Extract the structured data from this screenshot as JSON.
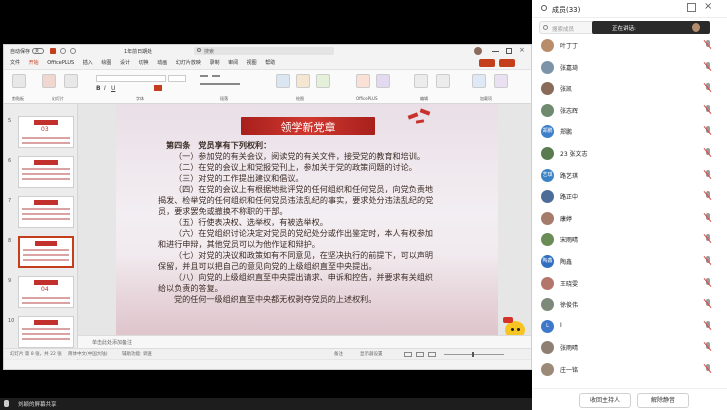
{
  "ppt": {
    "title_bar": {
      "autosave": "自动保存",
      "autosave_state": "关",
      "file_name": "1年前日期处",
      "search_placeholder": "搜索"
    },
    "menu": [
      "文件",
      "开始",
      "OfficePLUS",
      "插入",
      "绘图",
      "设计",
      "切换",
      "动画",
      "幻灯片放映",
      "录制",
      "审阅",
      "视图",
      "帮助"
    ],
    "active_menu": "开始",
    "ribbon_groups": [
      "剪贴板",
      "幻灯片",
      "字体",
      "段落",
      "绘图",
      "OfficePLUS",
      "编辑",
      "加载项"
    ],
    "thumbnails": [
      {
        "num": "5",
        "selected": false
      },
      {
        "num": "6",
        "selected": false
      },
      {
        "num": "7",
        "selected": false
      },
      {
        "num": "8",
        "selected": true
      },
      {
        "num": "9",
        "selected": false
      },
      {
        "num": "10",
        "selected": false
      }
    ],
    "thumb_badges": {
      "t5": "03",
      "t9": "04"
    },
    "slide": {
      "heading": "领学新党章",
      "lines": [
        "第四条　党员享有下列权利：",
        "（一）参加党的有关会议，阅读党的有关文件，接受党的教育和培训。",
        "（二）在党的会议上和党报党刊上，参加关于党的政策问题的讨论。",
        "（三）对党的工作提出建议和倡议。",
        "（四）在党的会议上有根据地批评党的任何组织和任何党员，向党负责地",
        "揭发、检举党的任何组织和任何党员违法乱纪的事实，要求处分违法乱纪的党",
        "员，要求罢免或撤换不称职的干部。",
        "（五）行使表决权、选举权，有被选举权。",
        "（六）在党组织讨论决定对党员的党纪处分或作出鉴定时，本人有权参加",
        "和进行申辩，其他党员可以为他作证和辩护。",
        "（七）对党的决议和政策如有不同意见，在坚决执行的前提下，可以声明",
        "保留，并且可以把自己的意见向党的上级组织直至中央提出。",
        "（八）向党的上级组织直至中央提出请求、申诉和控告，并要求有关组织",
        "给以负责的答复。",
        "党的任何一级组织直至中央都无权剥夺党员的上述权利。"
      ]
    },
    "notes_placeholder": "单击此处添加备注",
    "status": {
      "slide_info": "幻灯片 第 8 张，共 22 张",
      "language": "简体中文(中国大陆)",
      "accessibility": "辅助功能: 调查",
      "notes_btn": "备注",
      "display_btn": "显示器设置"
    }
  },
  "share_footer": {
    "text": "刘颖的屏幕共享"
  },
  "panel": {
    "title": "成员(33)",
    "search_placeholder": "搜索成员",
    "invite_label": "邀请",
    "speaking_label": "正在讲话:",
    "members": [
      {
        "name": "叶丁丁",
        "avatar_text": "",
        "color": "#b98d6a"
      },
      {
        "name": "张嘉琦",
        "avatar_text": "",
        "color": "#7c93a8"
      },
      {
        "name": "张凯",
        "avatar_text": "",
        "color": "#8a6a58"
      },
      {
        "name": "张志辉",
        "avatar_text": "",
        "color": "#6f8a6e"
      },
      {
        "name": "郑鹏",
        "avatar_text": "郑鹏",
        "color": "#3d7ec9"
      },
      {
        "name": "23 张文志",
        "avatar_text": "",
        "color": "#5a7b4f"
      },
      {
        "name": "路艺琪",
        "avatar_text": "艺琪",
        "color": "#3b82c4"
      },
      {
        "name": "路正中",
        "avatar_text": "",
        "color": "#4d6d98"
      },
      {
        "name": "康婷",
        "avatar_text": "",
        "color": "#a57b6b"
      },
      {
        "name": "宋雨晴",
        "avatar_text": "",
        "color": "#6a8d55"
      },
      {
        "name": "陶鑫",
        "avatar_text": "陶鑫",
        "color": "#2f6fbf"
      },
      {
        "name": "王晓雯",
        "avatar_text": "",
        "color": "#b4766b"
      },
      {
        "name": "徐俊伟",
        "avatar_text": "",
        "color": "#7d8a7a"
      },
      {
        "name": "I",
        "avatar_text": "L",
        "color": "#3f78c8"
      },
      {
        "name": "张雨晴",
        "avatar_text": "",
        "color": "#8e7f72"
      },
      {
        "name": "庄一铭",
        "avatar_text": "",
        "color": "#9c8a78"
      }
    ],
    "button_reclaim": "收回主持人",
    "button_unmute": "解除静音"
  },
  "colors": {
    "accent": "#c43e1c",
    "banner": "#c2302c",
    "slide_text": "#3b2b25"
  }
}
